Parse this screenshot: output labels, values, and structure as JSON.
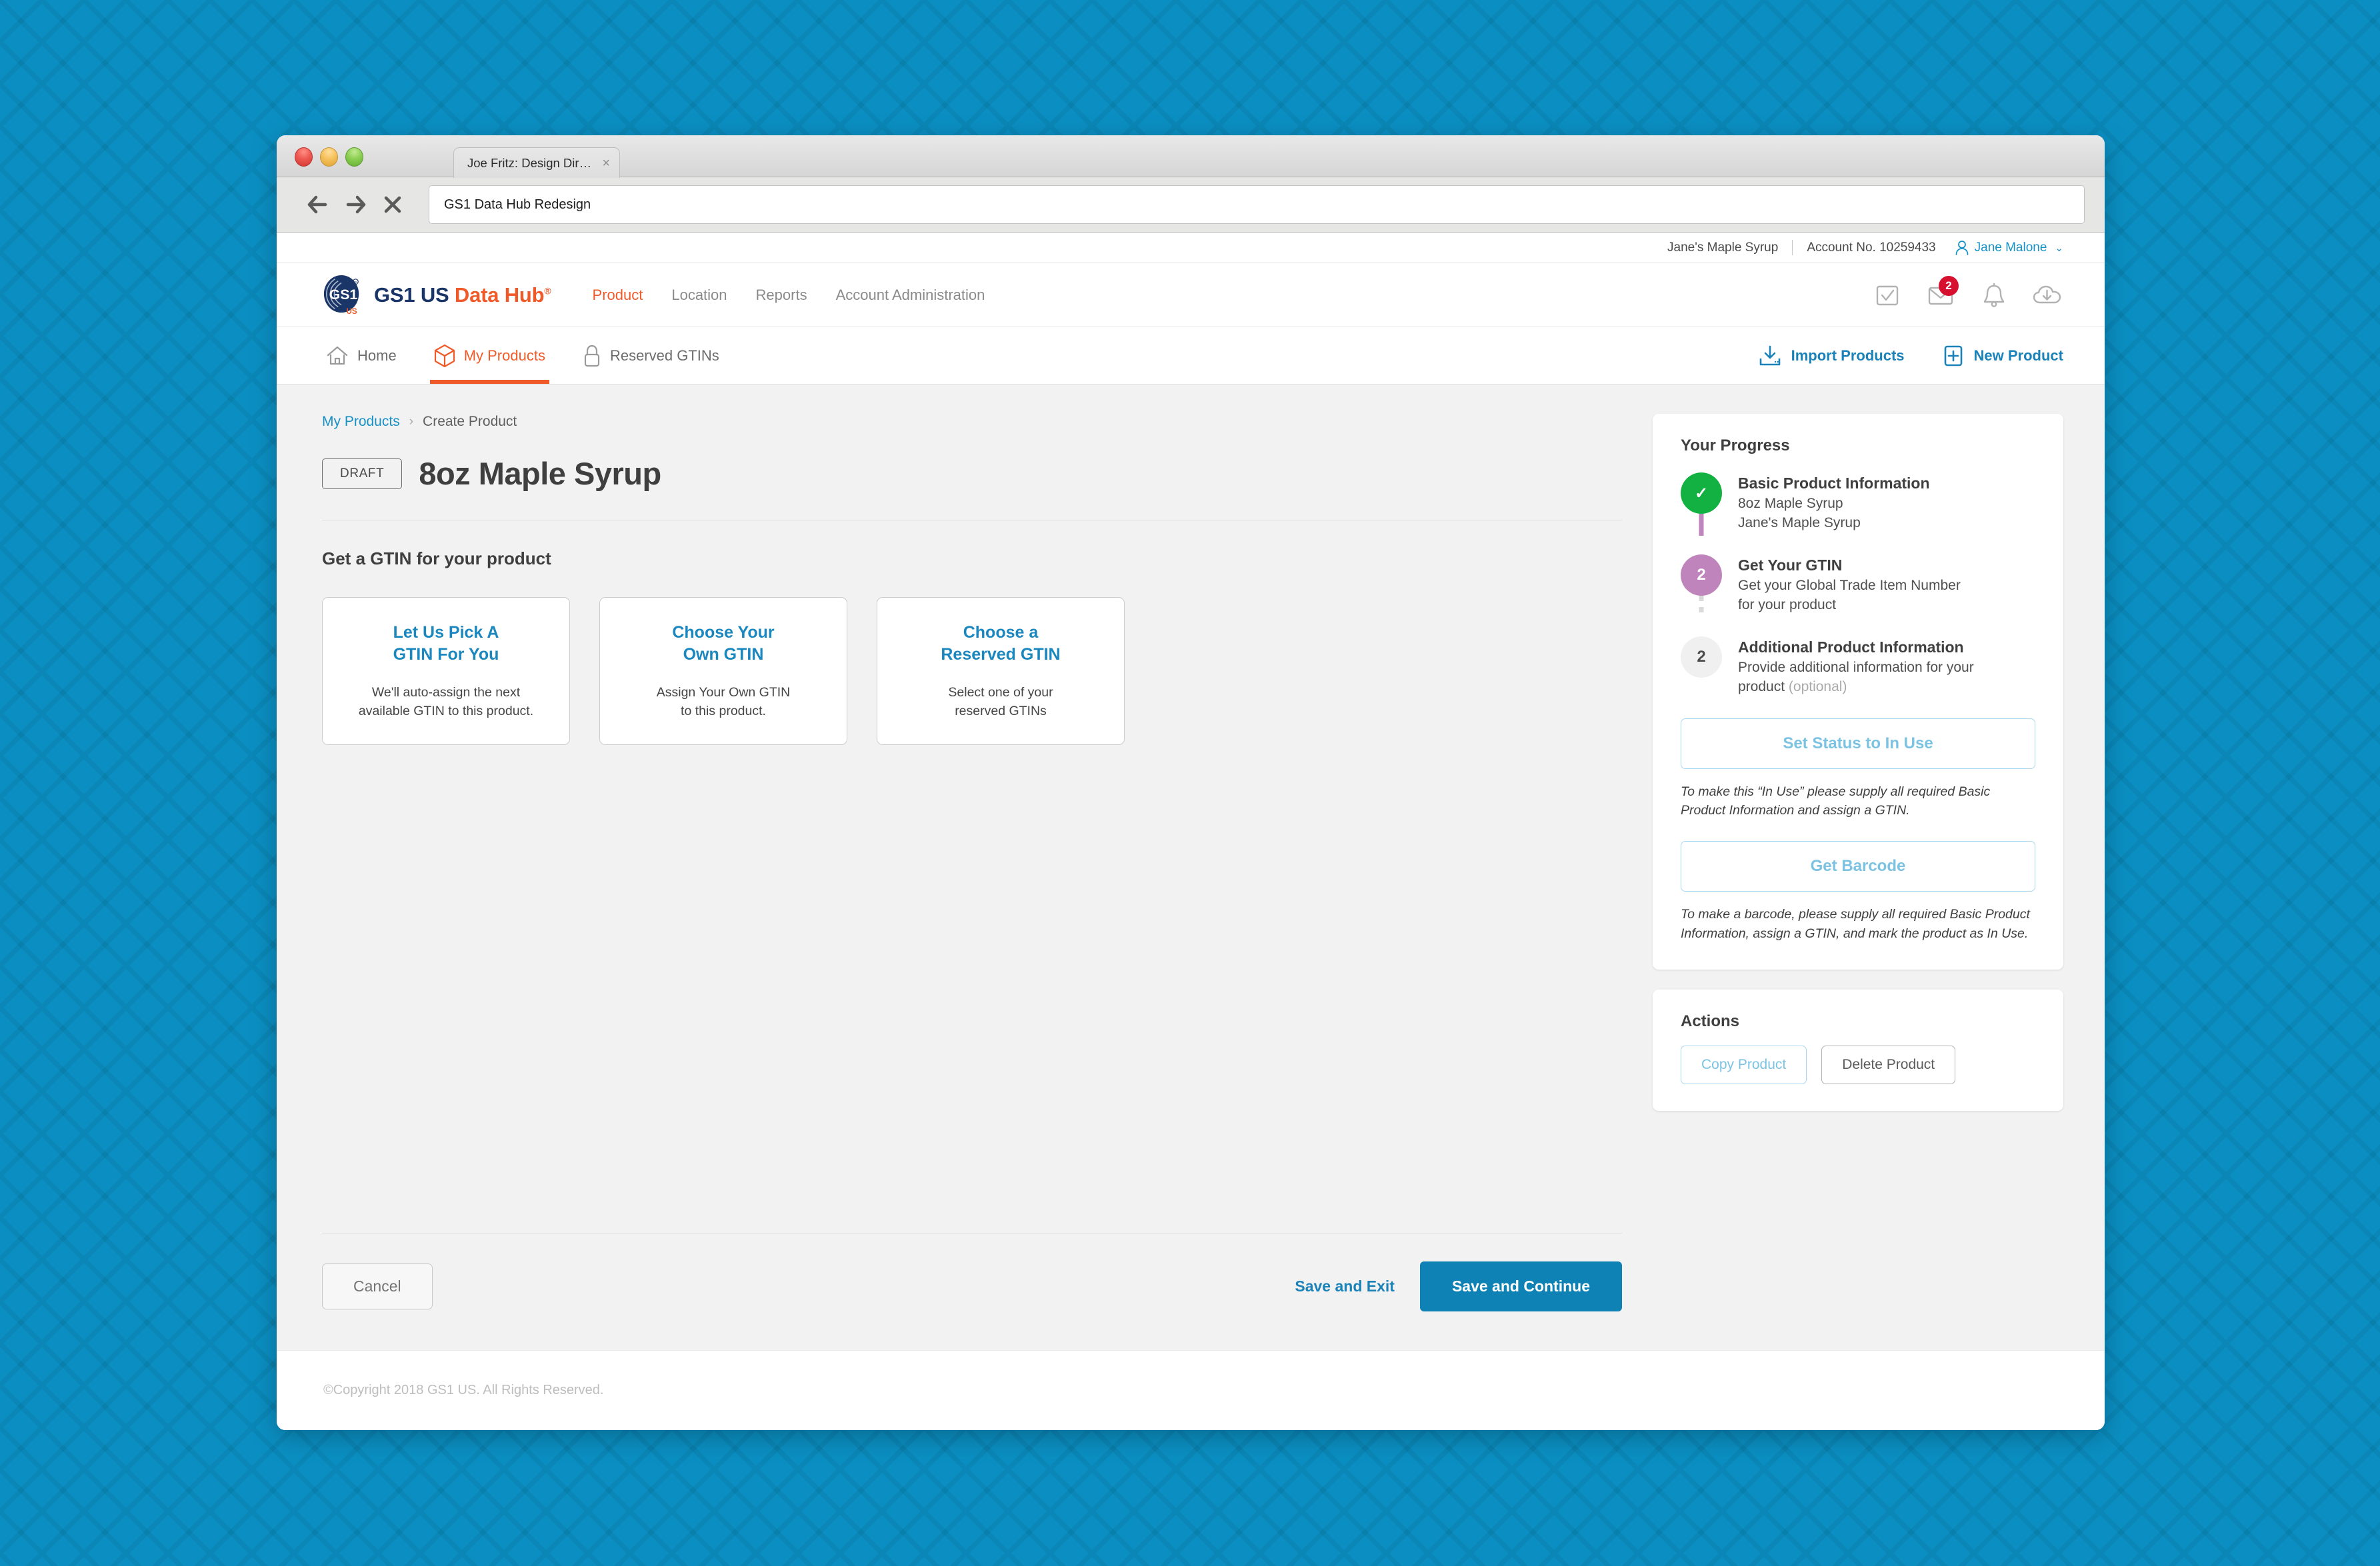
{
  "browser": {
    "tab_title": "Joe Fritz: Design Director",
    "tab_close_glyph": "×",
    "url_value": "GS1 Data Hub Redesign"
  },
  "account_bar": {
    "company": "Jane's Maple Syrup",
    "account_number": "Account No. 10259433",
    "user_name": "Jane Malone",
    "caret_glyph": "⌄"
  },
  "header": {
    "brand_blue": "GS1 US ",
    "brand_orange": "Data Hub",
    "brand_reg": "®",
    "nav": [
      {
        "label": "Product",
        "active": true
      },
      {
        "label": "Location",
        "active": false
      },
      {
        "label": "Reports",
        "active": false
      },
      {
        "label": "Account Administration",
        "active": false
      }
    ],
    "icons": [
      {
        "name": "checkbox-icon",
        "badge": null
      },
      {
        "name": "envelope-icon",
        "badge": "2"
      },
      {
        "name": "bell-icon",
        "badge": null
      },
      {
        "name": "cloud-download-icon",
        "badge": null
      }
    ]
  },
  "subnav": {
    "items": [
      {
        "label": "Home",
        "icon": "home-icon",
        "active": false
      },
      {
        "label": "My Products",
        "icon": "cube-icon",
        "active": true
      },
      {
        "label": "Reserved GTINs",
        "icon": "lock-icon",
        "active": false
      }
    ],
    "actions": [
      {
        "label": "Import Products",
        "icon": "import-icon"
      },
      {
        "label": "New Product",
        "icon": "plus-box-icon"
      }
    ]
  },
  "breadcrumb": {
    "link": "My Products",
    "chevron": "›",
    "current": "Create Product"
  },
  "product": {
    "status_badge": "DRAFT",
    "title": "8oz Maple Syrup"
  },
  "gtin_section": {
    "heading": "Get a GTIN for your product",
    "cards": [
      {
        "title_line1": "Let Us Pick A",
        "title_line2": "GTIN For You",
        "desc_line1": "We'll auto-assign the next",
        "desc_line2": "available GTIN to this product."
      },
      {
        "title_line1": "Choose Your",
        "title_line2": "Own GTIN",
        "desc_line1": "Assign Your Own GTIN",
        "desc_line2": "to this product."
      },
      {
        "title_line1": "Choose a",
        "title_line2": "Reserved GTIN",
        "desc_line1": "Select one of your",
        "desc_line2": "reserved GTINs"
      }
    ]
  },
  "bottom_actions": {
    "cancel": "Cancel",
    "save_exit": "Save and Exit",
    "save_continue": "Save and Continue"
  },
  "progress": {
    "panel_title": "Your Progress",
    "steps": [
      {
        "state": "done",
        "marker": "✓",
        "title": "Basic Product Information",
        "sub_line1": "8oz Maple Syrup",
        "sub_line2": "Jane's Maple Syrup",
        "optional": ""
      },
      {
        "state": "current",
        "marker": "2",
        "title": "Get Your GTIN",
        "sub_line1": "Get your Global Trade Item Number",
        "sub_line2": "for your product",
        "optional": ""
      },
      {
        "state": "todo",
        "marker": "2",
        "title": "Additional Product Information",
        "sub_line1": "Provide additional information for your",
        "sub_line2": "product ",
        "optional": "(optional)"
      }
    ],
    "set_status_button": "Set Status to In Use",
    "set_status_hint": "To make this “In Use” please supply all required Basic Product Information and assign a GTIN.",
    "barcode_button": "Get Barcode",
    "barcode_hint": "To make a barcode, please supply all required Basic Product Information, assign a GTIN, and mark the product as In Use."
  },
  "actions_panel": {
    "title": "Actions",
    "copy_button": "Copy Product",
    "delete_button": "Delete Product"
  },
  "footer": {
    "copyright": "©Copyright 2018 GS1 US. All Rights Reserved."
  },
  "colors": {
    "page_background": "#0b8fc2",
    "brand_orange": "#f05a28",
    "brand_navy": "#1a3668",
    "link_blue": "#1792c7",
    "primary_button": "#0e82b4",
    "step_done_green": "#12b141",
    "step_current_purple": "#bf84bc",
    "badge_red": "#d81030"
  }
}
